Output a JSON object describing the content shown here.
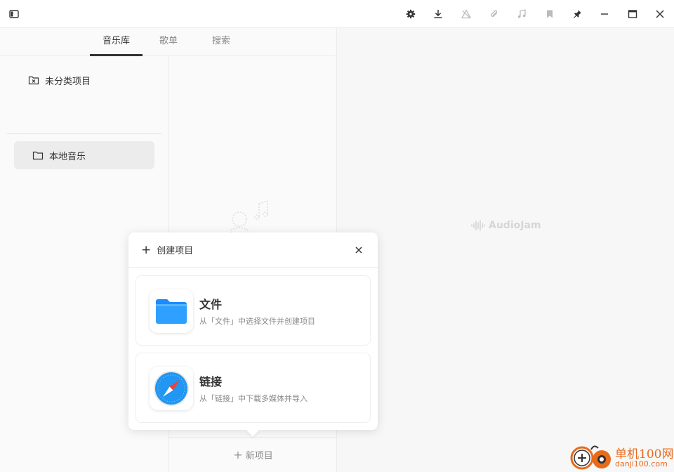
{
  "titlebar": {
    "icons": [
      "sidebar-toggle-icon",
      "gear-icon",
      "download-icon",
      "warning-icon",
      "paperclip-icon",
      "music-note-icon",
      "bookmark-icon",
      "pin-icon",
      "minimize-icon",
      "maximize-icon",
      "close-icon"
    ]
  },
  "tabs": [
    {
      "label": "音乐库",
      "active": true
    },
    {
      "label": "歌单",
      "active": false
    },
    {
      "label": "搜索",
      "active": false
    }
  ],
  "sidebar": {
    "items": [
      {
        "label": "未分类项目",
        "icon": "folder-x-icon"
      },
      {
        "label": "本地音乐",
        "icon": "folder-icon",
        "selected": true
      }
    ]
  },
  "middle": {
    "new_item_label": "新项目"
  },
  "right": {
    "brand": "AudioJam"
  },
  "popup": {
    "title": "创建项目",
    "options": [
      {
        "title": "文件",
        "desc": "从「文件」中选择文件并创建项目",
        "icon": "files-folder-icon"
      },
      {
        "title": "链接",
        "desc": "从「链接」中下载多媒体并导入",
        "icon": "safari-compass-icon"
      }
    ]
  },
  "watermark": {
    "site": "单机100网",
    "url": "danji100.com"
  },
  "colors": {
    "accent_blue": "#1a8cff",
    "watermark_orange": "#e86b1c"
  }
}
